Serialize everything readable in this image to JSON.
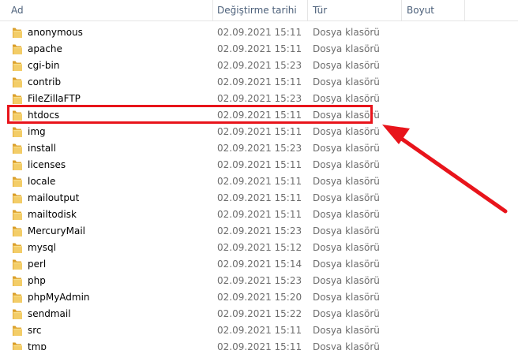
{
  "columns": {
    "name": "Ad",
    "date": "Değiştirme tarihi",
    "type": "Tür",
    "size": "Boyut"
  },
  "files": [
    {
      "name": "anonymous",
      "date": "02.09.2021 15:11",
      "type": "Dosya klasörü"
    },
    {
      "name": "apache",
      "date": "02.09.2021 15:11",
      "type": "Dosya klasörü"
    },
    {
      "name": "cgi-bin",
      "date": "02.09.2021 15:23",
      "type": "Dosya klasörü"
    },
    {
      "name": "contrib",
      "date": "02.09.2021 15:11",
      "type": "Dosya klasörü"
    },
    {
      "name": "FileZillaFTP",
      "date": "02.09.2021 15:23",
      "type": "Dosya klasörü"
    },
    {
      "name": "htdocs",
      "date": "02.09.2021 15:11",
      "type": "Dosya klasörü"
    },
    {
      "name": "img",
      "date": "02.09.2021 15:11",
      "type": "Dosya klasörü"
    },
    {
      "name": "install",
      "date": "02.09.2021 15:23",
      "type": "Dosya klasörü"
    },
    {
      "name": "licenses",
      "date": "02.09.2021 15:11",
      "type": "Dosya klasörü"
    },
    {
      "name": "locale",
      "date": "02.09.2021 15:11",
      "type": "Dosya klasörü"
    },
    {
      "name": "mailoutput",
      "date": "02.09.2021 15:11",
      "type": "Dosya klasörü"
    },
    {
      "name": "mailtodisk",
      "date": "02.09.2021 15:11",
      "type": "Dosya klasörü"
    },
    {
      "name": "MercuryMail",
      "date": "02.09.2021 15:23",
      "type": "Dosya klasörü"
    },
    {
      "name": "mysql",
      "date": "02.09.2021 15:12",
      "type": "Dosya klasörü"
    },
    {
      "name": "perl",
      "date": "02.09.2021 15:14",
      "type": "Dosya klasörü"
    },
    {
      "name": "php",
      "date": "02.09.2021 15:23",
      "type": "Dosya klasörü"
    },
    {
      "name": "phpMyAdmin",
      "date": "02.09.2021 15:20",
      "type": "Dosya klasörü"
    },
    {
      "name": "sendmail",
      "date": "02.09.2021 15:22",
      "type": "Dosya klasörü"
    },
    {
      "name": "src",
      "date": "02.09.2021 15:11",
      "type": "Dosya klasörü"
    },
    {
      "name": "tmp",
      "date": "02.09.2021 15:11",
      "type": "Dosya klasörü"
    }
  ],
  "icons": {
    "folder": "folder-icon",
    "sort": "sort-ascending-icon"
  },
  "colors": {
    "header_text": "#4c607a",
    "annotation": "#e8141b",
    "folder": "#e8b84a"
  },
  "annotation": {
    "highlighted_item": "htdocs"
  }
}
